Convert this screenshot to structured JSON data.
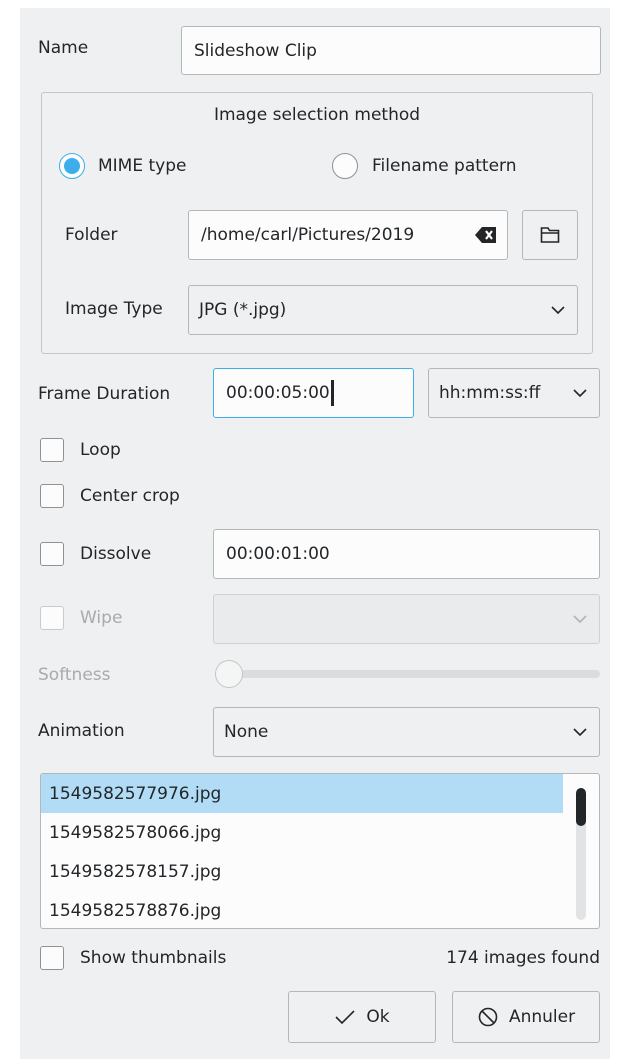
{
  "name": {
    "label": "Name",
    "value": "Slideshow Clip"
  },
  "selection": {
    "title": "Image selection method",
    "options": [
      "MIME type",
      "Filename pattern"
    ],
    "selected": "MIME type",
    "folder_label": "Folder",
    "folder_value": "/home/carl/Pictures/2019",
    "image_type_label": "Image Type",
    "image_type_value": "JPG (*.jpg)"
  },
  "frame_duration": {
    "label": "Frame Duration",
    "value": "00:00:05:00",
    "format": "hh:mm:ss:ff"
  },
  "options": {
    "loop": {
      "label": "Loop",
      "checked": false
    },
    "center_crop": {
      "label": "Center crop",
      "checked": false
    },
    "dissolve": {
      "label": "Dissolve",
      "checked": false,
      "value": "00:00:01:00"
    },
    "wipe": {
      "label": "Wipe",
      "checked": false,
      "enabled": false,
      "value": ""
    },
    "softness": {
      "label": "Softness",
      "enabled": false,
      "level": 0
    }
  },
  "animation": {
    "label": "Animation",
    "value": "None"
  },
  "files": [
    "1549582577976.jpg",
    "1549582578066.jpg",
    "1549582578157.jpg",
    "1549582578876.jpg"
  ],
  "selected_file": "1549582577976.jpg",
  "footer": {
    "show_thumbnails": "Show thumbnails",
    "count_text": "174 images found"
  },
  "buttons": {
    "ok": "Ok",
    "cancel": "Annuler"
  },
  "colors": {
    "accent": "#3daee9",
    "selection": "#b2dcf6",
    "background": "#eff0f1"
  }
}
